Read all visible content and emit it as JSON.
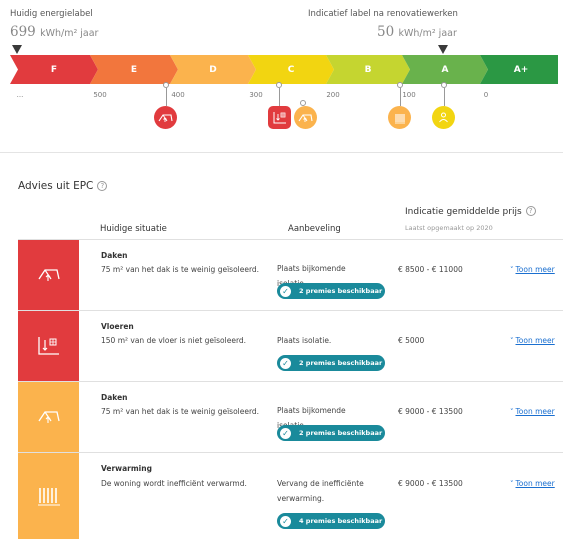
{
  "current": {
    "label": "Huidig energielabel",
    "value": "699",
    "unit": "kWh/m² jaar"
  },
  "renovated": {
    "label": "Indicatief label na renovatiewerken",
    "value": "50",
    "unit": "kWh/m² jaar"
  },
  "scale": {
    "segments": [
      {
        "label": "F",
        "color": "#e13b3e"
      },
      {
        "label": "E",
        "color": "#f2763d"
      },
      {
        "label": "D",
        "color": "#fbb34d"
      },
      {
        "label": "C",
        "color": "#f2d511"
      },
      {
        "label": "B",
        "color": "#c5d530"
      },
      {
        "label": "A",
        "color": "#69b24c"
      },
      {
        "label": "A+",
        "color": "#2b9844"
      }
    ],
    "ticks": [
      "...",
      "500",
      "400",
      "300",
      "200",
      "100",
      "0"
    ]
  },
  "colors": {
    "red": "#e13b3e",
    "orange": "#fbb34d",
    "yellow": "#f2d511",
    "teal": "#1a8a9b",
    "link": "#1a6fd0"
  },
  "pins": [
    {
      "icon": "roof-icon",
      "color": "#e13b3e"
    },
    {
      "icon": "floor-icon",
      "color": "#e13b3e"
    },
    {
      "icon": "roof-icon",
      "color": "#fbb34d"
    },
    {
      "icon": "radiator-icon",
      "color": "#fbb34d"
    },
    {
      "icon": "person-icon",
      "color": "#f2d511"
    }
  ],
  "advice": {
    "title": "Advies uit EPC",
    "help": "?",
    "headers": {
      "situation": "Huidige situatie",
      "recommendation": "Aanbeveling",
      "price": "Indicatie gemiddelde prijs",
      "price_sub": "Laatst opgemaakt op 2020"
    },
    "rows": [
      {
        "icon": "roof-icon",
        "color": "#e13b3e",
        "title": "Daken",
        "desc": "75 m² van het dak is te weinig geïsoleerd.",
        "rec": "Plaats bijkomende isolatie.",
        "badge": "2 premies beschikbaar",
        "price": "€ 8500 - € 11000",
        "more": "Toon meer"
      },
      {
        "icon": "floor-icon",
        "color": "#e13b3e",
        "title": "Vloeren",
        "desc": "150 m² van de vloer is niet geïsoleerd.",
        "rec": "Plaats isolatie.",
        "badge": "2 premies beschikbaar",
        "price": "€ 5000",
        "more": "Toon meer"
      },
      {
        "icon": "roof-icon",
        "color": "#fbb34d",
        "title": "Daken",
        "desc": "75 m² van het dak is te weinig geïsoleerd.",
        "rec": "Plaats bijkomende isolatie.",
        "badge": "2 premies beschikbaar",
        "price": "€ 9000 - € 13500",
        "more": "Toon meer"
      },
      {
        "icon": "radiator-icon",
        "color": "#fbb34d",
        "title": "Verwarming",
        "desc": "De woning wordt inefficiënt verwarmd.",
        "rec": "Vervang de inefficiënte verwarming.",
        "badge": "4 premies beschikbaar",
        "price": "€ 9000 - € 13500",
        "more": "Toon meer"
      }
    ]
  }
}
